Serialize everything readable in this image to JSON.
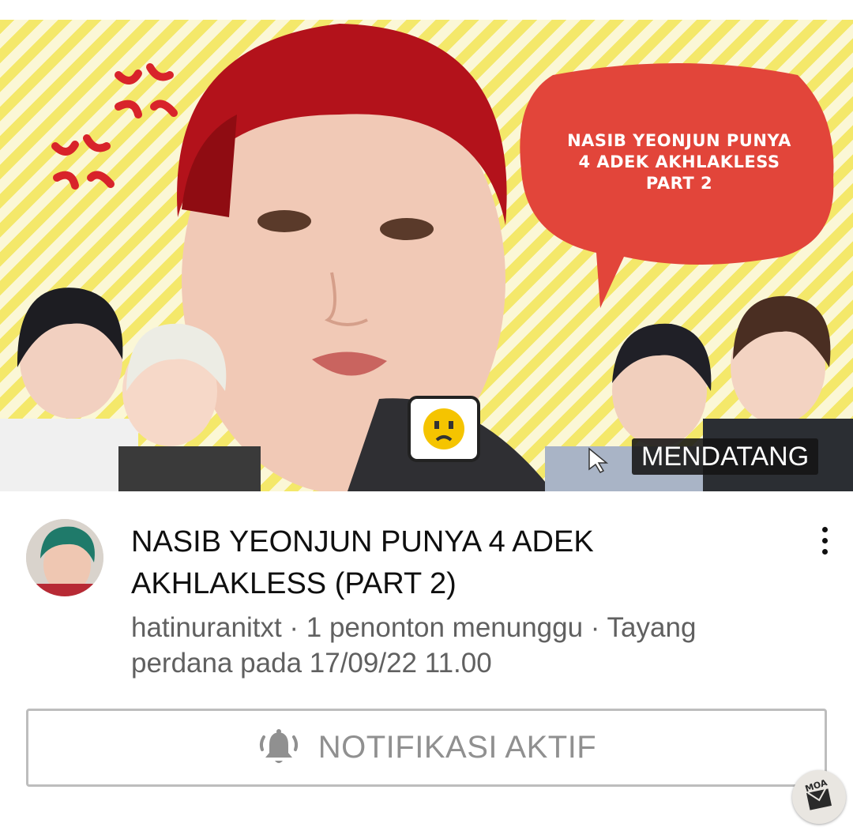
{
  "thumbnail": {
    "overlay_text_lines": [
      "NASIB YEONJUN PUNYA",
      "4 ADEK AKHLAKLESS",
      "PART 2"
    ],
    "badge": "MENDATANG",
    "icons": {
      "cast": "cast-icon",
      "emoji": "crying-emoji-icon",
      "anger": "anger-mark-icon"
    },
    "colors": {
      "bubble": "#e2453a",
      "stripe": "#f4e86a"
    }
  },
  "video": {
    "title": "NASIB YEONJUN PUNYA 4 ADEK AKHLAKLESS (PART 2)",
    "meta": "hatinuranitxt · 1 penonton menunggu · Tayang perdana pada 17/09/22 11.00"
  },
  "actions": {
    "more_icon": "more-vertical-icon",
    "notify_label": "NOTIFIKASI AKTIF",
    "notify_icon": "bell-ringing-icon"
  },
  "watermark": {
    "text": "MOA"
  }
}
